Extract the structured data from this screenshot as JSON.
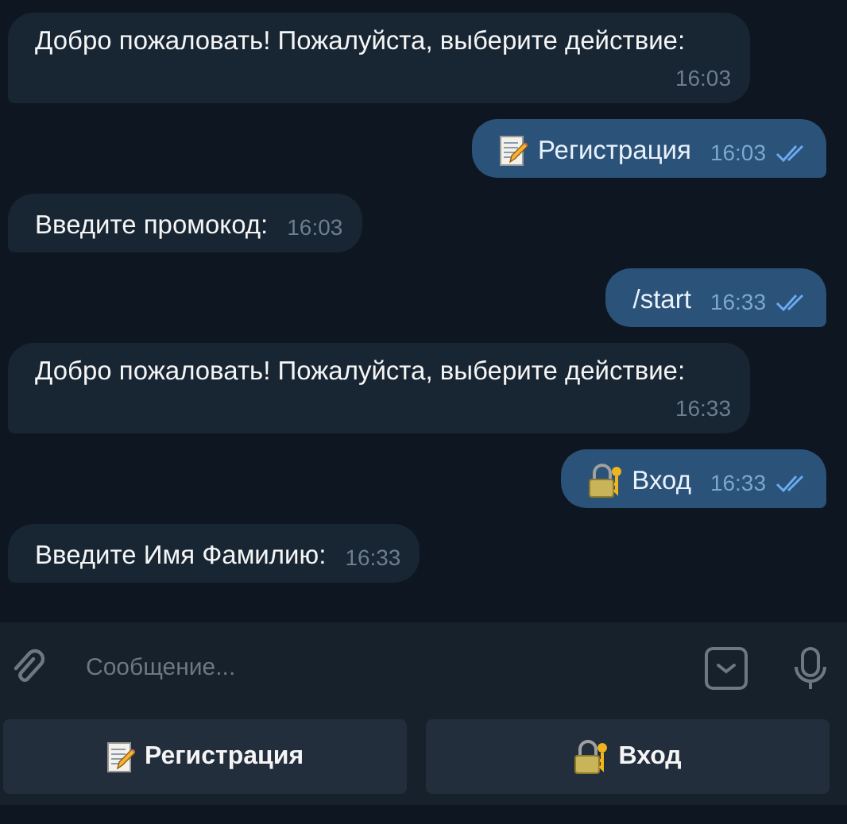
{
  "messages": [
    {
      "kind": "incoming",
      "text": "Добро пожаловать! Пожалуйста, выберите действие:",
      "time": "16:03"
    },
    {
      "kind": "outgoing",
      "emoji": {
        "kind": "memo"
      },
      "text": "Регистрация",
      "time": "16:03",
      "read": true
    },
    {
      "kind": "incoming",
      "text": "Введите промокод:",
      "time": "16:03"
    },
    {
      "kind": "outgoing",
      "text": "/start",
      "time": "16:33",
      "read": true
    },
    {
      "kind": "incoming",
      "text": "Добро пожаловать! Пожалуйста, выберите действие:",
      "time": "16:33"
    },
    {
      "kind": "outgoing",
      "emoji": {
        "kind": "lock"
      },
      "text": "Вход",
      "time": "16:33",
      "read": true
    },
    {
      "kind": "incoming",
      "text": "Введите Имя Фамилию:",
      "time": "16:33"
    }
  ],
  "composer": {
    "placeholder": "Сообщение..."
  },
  "keyboard": [
    {
      "kind": "memo",
      "label": "Регистрация"
    },
    {
      "kind": "lock",
      "label": "Вход"
    }
  ]
}
